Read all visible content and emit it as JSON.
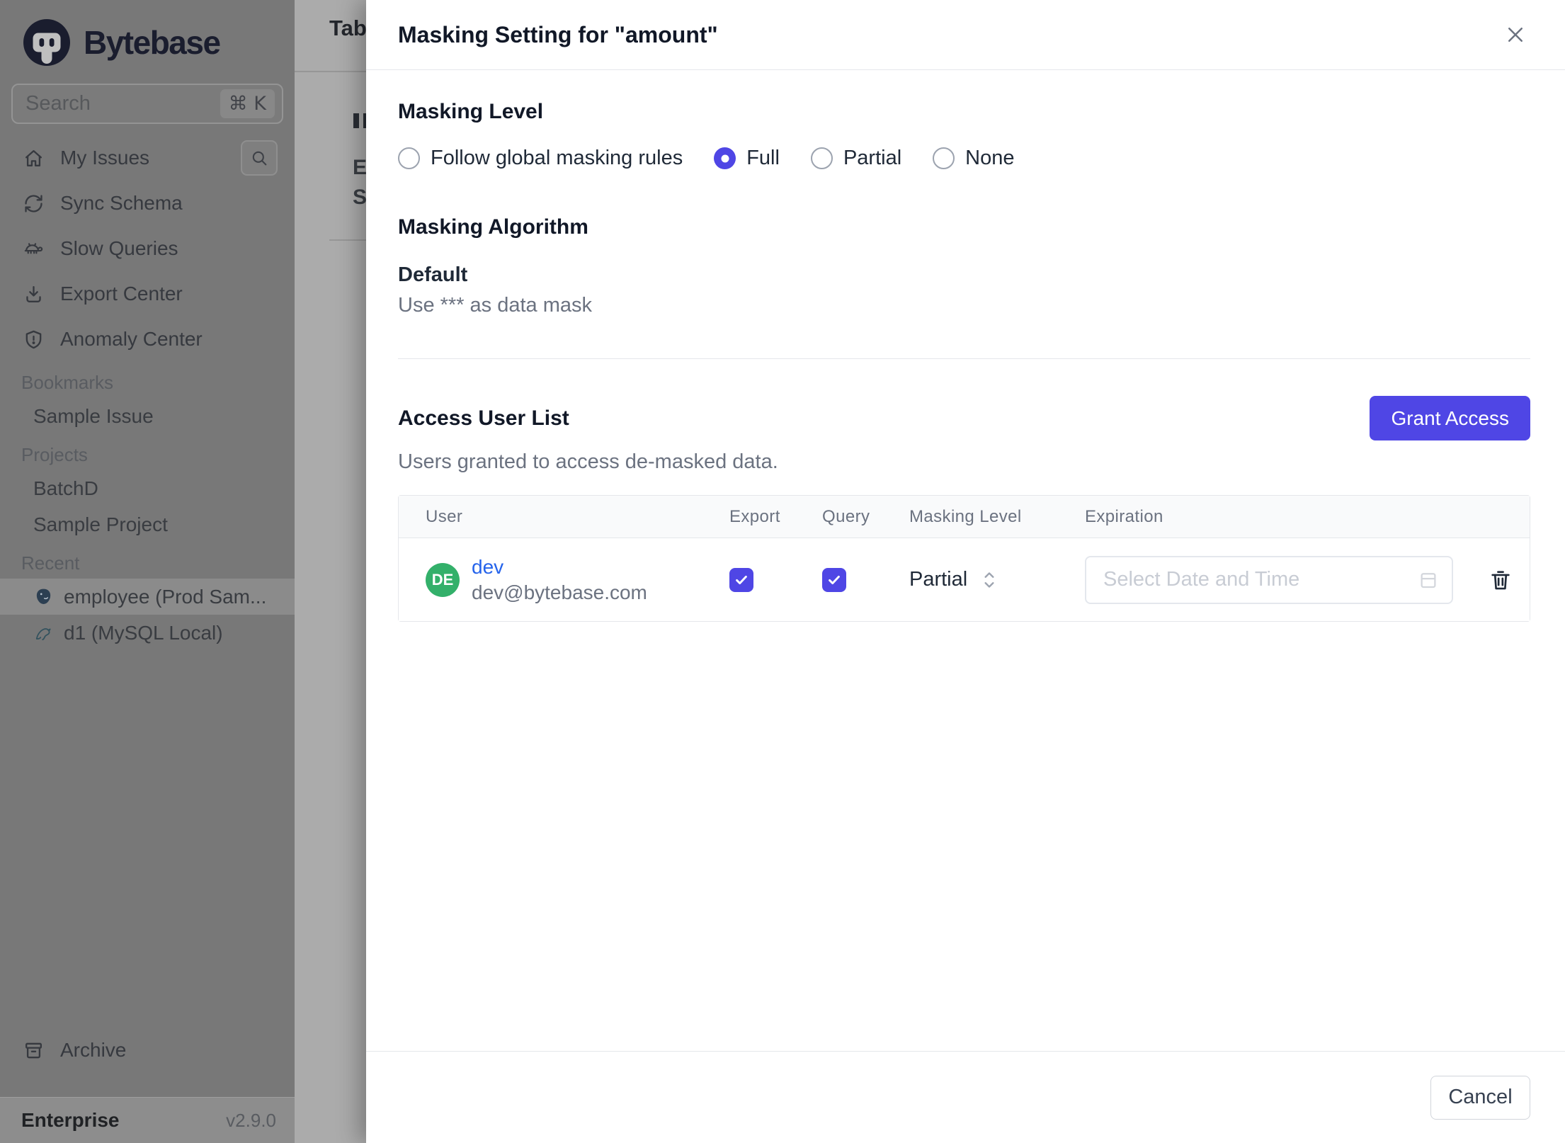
{
  "sidebar": {
    "logo_text": "Bytebase",
    "search": {
      "placeholder": "Search",
      "shortcut": "⌘ K"
    },
    "nav": [
      {
        "label": "My Issues",
        "icon": "home-icon"
      },
      {
        "label": "Sync Schema",
        "icon": "sync-icon"
      },
      {
        "label": "Slow Queries",
        "icon": "turtle-icon"
      },
      {
        "label": "Export Center",
        "icon": "download-icon"
      },
      {
        "label": "Anomaly Center",
        "icon": "shield-icon"
      }
    ],
    "sections": [
      {
        "title": "Bookmarks",
        "items": [
          {
            "label": "Sample Issue"
          }
        ]
      },
      {
        "title": "Projects",
        "items": [
          {
            "label": "BatchD"
          },
          {
            "label": "Sample Project"
          }
        ]
      },
      {
        "title": "Recent",
        "items": [
          {
            "label": "employee (Prod Sam...",
            "icon": "postgresql-icon",
            "active": true
          },
          {
            "label": "d1 (MySQL Local)",
            "icon": "mysql-icon",
            "active": false
          }
        ]
      }
    ],
    "archive_label": "Archive",
    "plan": {
      "name": "Enterprise",
      "version": "v2.9.0"
    }
  },
  "background_page": {
    "heading": "Tab",
    "partial_label_1": "E",
    "partial_label_2": "S"
  },
  "modal": {
    "title": "Masking Setting for \"amount\"",
    "masking_level": {
      "heading": "Masking Level",
      "options": [
        {
          "label": "Follow global masking rules",
          "selected": false
        },
        {
          "label": "Full",
          "selected": true
        },
        {
          "label": "Partial",
          "selected": false
        },
        {
          "label": "None",
          "selected": false
        }
      ]
    },
    "masking_algorithm": {
      "heading": "Masking Algorithm",
      "name": "Default",
      "description": "Use *** as data mask"
    },
    "access_user_list": {
      "heading": "Access User List",
      "subtitle": "Users granted to access de-masked data.",
      "grant_button_label": "Grant Access",
      "table": {
        "columns": [
          "User",
          "Export",
          "Query",
          "Masking Level",
          "Expiration"
        ],
        "rows": [
          {
            "avatar_initials": "DE",
            "name": "dev",
            "email": "dev@bytebase.com",
            "export_checked": true,
            "query_checked": true,
            "masking_level": "Partial",
            "expiration_placeholder": "Select Date and Time"
          }
        ]
      }
    },
    "footer": {
      "cancel_label": "Cancel"
    }
  },
  "colors": {
    "accent": "#4f46e5",
    "avatar_green": "#33b06a",
    "link_blue": "#2563eb"
  }
}
